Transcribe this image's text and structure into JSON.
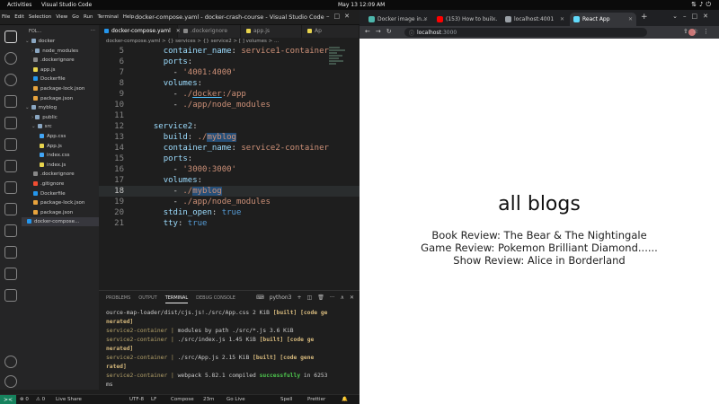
{
  "topbar": {
    "activities": "Activities",
    "app_name": "Visual Studio Code",
    "clock": "May 13  12:09 AM"
  },
  "vscode": {
    "menu": [
      "File",
      "Edit",
      "Selection",
      "View",
      "Go",
      "Run",
      "Terminal",
      "Help"
    ],
    "window_title": "docker-compose.yaml - docker-crash-course - Visual Studio Code",
    "sidebar": {
      "header": "FOL...",
      "items": [
        {
          "label": "docker",
          "depth": 1,
          "kind": "folder-open"
        },
        {
          "label": "node_modules",
          "depth": 2,
          "kind": "folder"
        },
        {
          "label": ".dockerignore",
          "depth": 2,
          "kind": "file"
        },
        {
          "label": "app.js",
          "depth": 2,
          "kind": "js"
        },
        {
          "label": "Dockerfile",
          "depth": 2,
          "kind": "docker"
        },
        {
          "label": "package-lock.json",
          "depth": 2,
          "kind": "json"
        },
        {
          "label": "package.json",
          "depth": 2,
          "kind": "json"
        },
        {
          "label": "myblog",
          "depth": 1,
          "kind": "folder-open"
        },
        {
          "label": "public",
          "depth": 2,
          "kind": "folder"
        },
        {
          "label": "src",
          "depth": 2,
          "kind": "folder-open"
        },
        {
          "label": "App.css",
          "depth": 3,
          "kind": "css"
        },
        {
          "label": "App.js",
          "depth": 3,
          "kind": "js"
        },
        {
          "label": "index.css",
          "depth": 3,
          "kind": "css"
        },
        {
          "label": "index.js",
          "depth": 3,
          "kind": "js"
        },
        {
          "label": ".dockerignore",
          "depth": 2,
          "kind": "file"
        },
        {
          "label": ".gitignore",
          "depth": 2,
          "kind": "git"
        },
        {
          "label": "Dockerfile",
          "depth": 2,
          "kind": "docker"
        },
        {
          "label": "package-lock.json",
          "depth": 2,
          "kind": "json"
        },
        {
          "label": "package.json",
          "depth": 2,
          "kind": "json"
        },
        {
          "label": "docker-compose...",
          "depth": 1,
          "kind": "docker",
          "selected": true
        }
      ]
    },
    "tabs": [
      {
        "label": "docker-compose.yaml",
        "active": true
      },
      {
        "label": ".dockerignore",
        "active": false
      },
      {
        "label": "app.js",
        "active": false
      },
      {
        "label": "Ap",
        "active": false
      }
    ],
    "breadcrumb": "docker-compose.yaml > {} services > {} service2 > [ ] volumes > ...",
    "code_lines": [
      {
        "n": "5",
        "text": "    container_name: service1-container"
      },
      {
        "n": "6",
        "text": "    ports:"
      },
      {
        "n": "7",
        "text": "      - '4001:4000'"
      },
      {
        "n": "8",
        "text": "    volumes:"
      },
      {
        "n": "9",
        "text": "      - ./docker:/app"
      },
      {
        "n": "10",
        "text": "      - ./app/node_modules"
      },
      {
        "n": "11",
        "text": ""
      },
      {
        "n": "12",
        "text": "  service2:"
      },
      {
        "n": "13",
        "text": "    build: ./myblog"
      },
      {
        "n": "14",
        "text": "    container_name: service2-container"
      },
      {
        "n": "15",
        "text": "    ports:"
      },
      {
        "n": "16",
        "text": "      - '3000:3000'"
      },
      {
        "n": "17",
        "text": "    volumes:"
      },
      {
        "n": "18",
        "text": "      - ./myblog"
      },
      {
        "n": "19",
        "text": "      - ./app/node_modules"
      },
      {
        "n": "20",
        "text": "    stdin_open: true"
      },
      {
        "n": "21",
        "text": "    tty: true"
      }
    ],
    "current_line": "18",
    "panel": {
      "tabs": [
        "PROBLEMS",
        "OUTPUT",
        "TERMINAL",
        "DEBUG CONSOLE"
      ],
      "active_tab": "TERMINAL",
      "shell": "python3",
      "terminal_lines": [
        {
          "a": "ource-map-loader/dist/cjs.js!./src/App.css 2 KiB ",
          "b": "[built] [code ge",
          "style": "first"
        },
        {
          "a": "",
          "b": "nerated]",
          "style": "yellow-only"
        },
        {
          "a": "service2-container | ",
          "b": "   modules by path ./src/*.js 3.6 KiB",
          "style": "plain"
        },
        {
          "a": "service2-container | ",
          "b": "     ./src/index.js 1.45 KiB [built] [code ge",
          "style": "built"
        },
        {
          "a": "",
          "b": "nerated]",
          "style": "yellow-only"
        },
        {
          "a": "service2-container | ",
          "b": "     ./src/App.js 2.15 KiB [built] [code gene",
          "style": "built"
        },
        {
          "a": "",
          "b": "rated]",
          "style": "yellow-only"
        },
        {
          "a": "service2-container | ",
          "b": "webpack 5.82.1 compiled successfully in 6253",
          "style": "success"
        },
        {
          "a": "",
          "b": " ms",
          "style": "plain-tail"
        }
      ]
    },
    "status": {
      "errors": "⊗ 0",
      "warnings": "⚠ 0",
      "live_share": "Live Share",
      "encoding": "UTF-8",
      "eol": "LF",
      "language": "Compose",
      "temp": "23m",
      "go_live": "Go Live",
      "spell": "Spell",
      "prettier": "Prettier"
    }
  },
  "browser": {
    "tabs": [
      {
        "label": "Docker image in...",
        "favicon_color": "#4db6ac"
      },
      {
        "label": "(153) How to buil...",
        "favicon_color": "#ff0000"
      },
      {
        "label": "localhost:4001",
        "favicon_color": "#9aa0a6"
      },
      {
        "label": "React App",
        "favicon_color": "#61dafb",
        "active": true
      }
    ],
    "url_host": "localhost",
    "url_port": ":3000",
    "content": {
      "heading": "all blogs",
      "blogs": [
        "Book Review: The Bear & The Nightingale",
        "Game Review: Pokemon Brilliant Diamond......",
        "Show Review: Alice in Borderland"
      ]
    }
  }
}
